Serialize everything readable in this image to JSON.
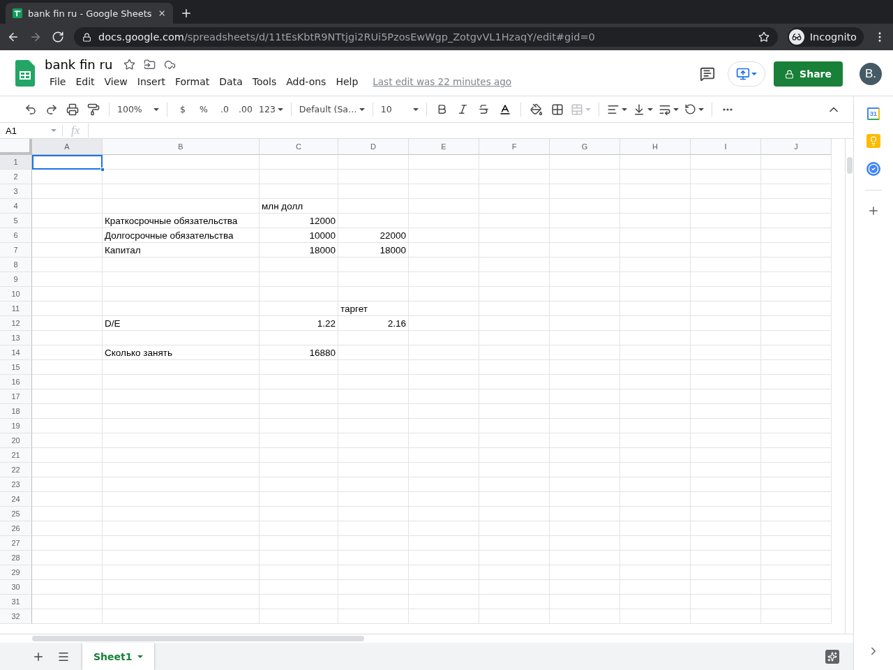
{
  "browser": {
    "tab_title": "bank fin ru - Google Sheets",
    "url_host": "docs.google.com",
    "url_path": "/spreadsheets/d/11tEsKbtR9NTtjgi2RUi5PzosEwWgp_ZotgvVL1HzaqY/edit#gid=0",
    "profile": "Incognito"
  },
  "document": {
    "title": "bank fin ru",
    "menu": [
      "File",
      "Edit",
      "View",
      "Insert",
      "Format",
      "Data",
      "Tools",
      "Add-ons",
      "Help"
    ],
    "last_edit": "Last edit was 22 minutes ago",
    "share": "Share",
    "avatar": "B."
  },
  "toolbar": {
    "zoom": "100%",
    "currency": "$",
    "percent": "%",
    "decrease_decimals": ".0",
    "increase_decimals": ".00",
    "more_formats": "123",
    "font": "Default (Sa…",
    "font_size": "10"
  },
  "formula_bar": {
    "name_box": "A1",
    "fx": "fx"
  },
  "sheet": {
    "columns": [
      "A",
      "B",
      "C",
      "D",
      "E",
      "F",
      "G",
      "H",
      "I",
      "J"
    ],
    "rows": [
      {
        "number": "1",
        "cells": [
          {
            "selected": true
          },
          {
            "selected": false
          },
          {
            "selected": false
          },
          {
            "selected": false
          },
          {
            "selected": false
          },
          {
            "selected": false
          },
          {
            "selected": false
          },
          {
            "selected": false
          },
          {
            "selected": false
          },
          {
            "selected": false
          }
        ]
      },
      {
        "number": "2"
      },
      {
        "number": "3"
      },
      {
        "number": "4",
        "cells": [
          {
            "selected": false
          },
          {
            "selected": false
          },
          {
            "text": "млн долл",
            "kind": "text",
            "selected": false
          },
          {
            "selected": false
          },
          {
            "selected": false
          },
          {
            "selected": false
          },
          {
            "selected": false
          },
          {
            "selected": false
          },
          {
            "selected": false
          },
          {
            "selected": false
          }
        ]
      },
      {
        "number": "5",
        "cells": [
          {
            "selected": false
          },
          {
            "text": "Краткосрочные обязательства",
            "kind": "text",
            "selected": false
          },
          {
            "text": "12000",
            "kind": "number",
            "selected": false
          },
          {
            "selected": false
          },
          {
            "selected": false
          },
          {
            "selected": false
          },
          {
            "selected": false
          },
          {
            "selected": false
          },
          {
            "selected": false
          },
          {
            "selected": false
          }
        ]
      },
      {
        "number": "6",
        "cells": [
          {
            "selected": false
          },
          {
            "text": "Долгосрочные обязательства",
            "kind": "text",
            "selected": false
          },
          {
            "text": "10000",
            "kind": "number",
            "selected": false
          },
          {
            "text": "22000",
            "kind": "number",
            "selected": false
          },
          {
            "selected": false
          },
          {
            "selected": false
          },
          {
            "selected": false
          },
          {
            "selected": false
          },
          {
            "selected": false
          },
          {
            "selected": false
          }
        ]
      },
      {
        "number": "7",
        "cells": [
          {
            "selected": false
          },
          {
            "text": "Капитал",
            "kind": "text",
            "selected": false
          },
          {
            "text": "18000",
            "kind": "number",
            "selected": false
          },
          {
            "text": "18000",
            "kind": "number",
            "selected": false
          },
          {
            "selected": false
          },
          {
            "selected": false
          },
          {
            "selected": false
          },
          {
            "selected": false
          },
          {
            "selected": false
          },
          {
            "selected": false
          }
        ]
      },
      {
        "number": "8"
      },
      {
        "number": "9"
      },
      {
        "number": "10"
      },
      {
        "number": "11",
        "cells": [
          {
            "selected": false
          },
          {
            "selected": false
          },
          {
            "selected": false
          },
          {
            "text": "таргет",
            "kind": "text",
            "selected": false
          },
          {
            "selected": false
          },
          {
            "selected": false
          },
          {
            "selected": false
          },
          {
            "selected": false
          },
          {
            "selected": false
          },
          {
            "selected": false
          }
        ]
      },
      {
        "number": "12",
        "cells": [
          {
            "selected": false
          },
          {
            "text": "D/E",
            "kind": "text",
            "selected": false
          },
          {
            "text": "1.22",
            "kind": "number",
            "selected": false
          },
          {
            "text": "2.16",
            "kind": "number",
            "selected": false
          },
          {
            "selected": false
          },
          {
            "selected": false
          },
          {
            "selected": false
          },
          {
            "selected": false
          },
          {
            "selected": false
          },
          {
            "selected": false
          }
        ]
      },
      {
        "number": "13"
      },
      {
        "number": "14",
        "cells": [
          {
            "selected": false
          },
          {
            "text": "Сколько занять",
            "kind": "text",
            "selected": false
          },
          {
            "text": "16880",
            "kind": "number",
            "selected": false
          },
          {
            "selected": false
          },
          {
            "selected": false
          },
          {
            "selected": false
          },
          {
            "selected": false
          },
          {
            "selected": false
          },
          {
            "selected": false
          },
          {
            "selected": false
          }
        ]
      },
      {
        "number": "15"
      },
      {
        "number": "16"
      },
      {
        "number": "17"
      },
      {
        "number": "18"
      },
      {
        "number": "19"
      },
      {
        "number": "20"
      },
      {
        "number": "21"
      },
      {
        "number": "22"
      },
      {
        "number": "23"
      },
      {
        "number": "24"
      },
      {
        "number": "25"
      },
      {
        "number": "26"
      },
      {
        "number": "27"
      },
      {
        "number": "28"
      },
      {
        "number": "29"
      },
      {
        "number": "30"
      },
      {
        "number": "31"
      },
      {
        "number": "32"
      }
    ]
  },
  "sheet_tabs": [
    {
      "label": "Sheet1",
      "selected": true
    }
  ],
  "side_panel": {
    "calendar_day": "31"
  }
}
